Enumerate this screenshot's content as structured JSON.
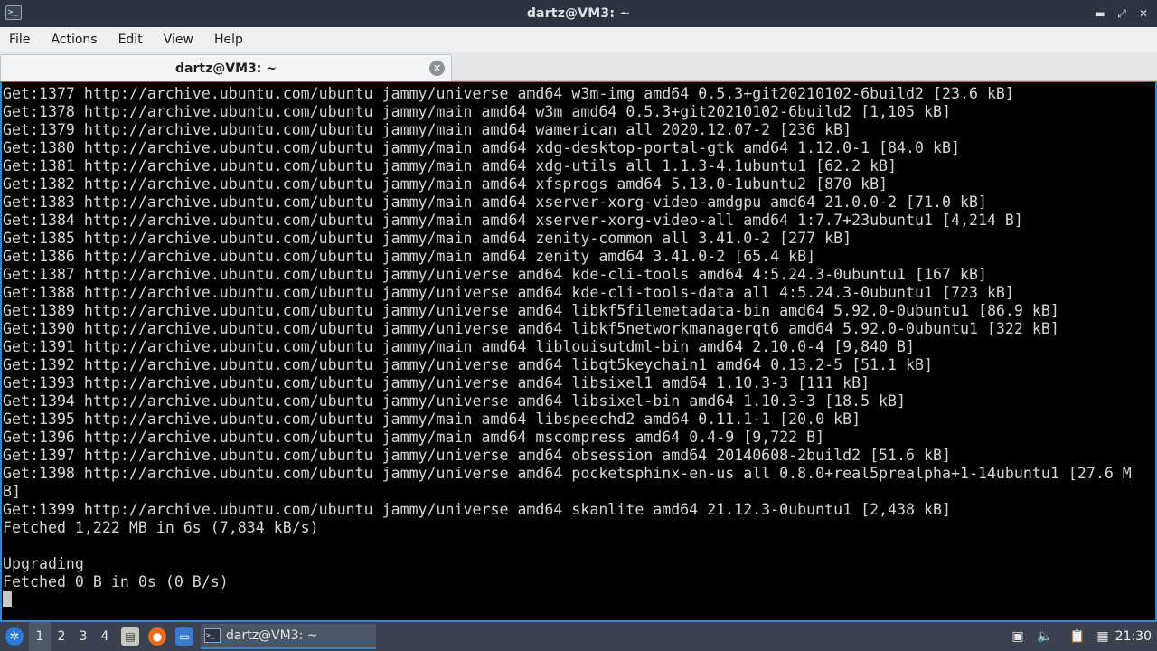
{
  "window": {
    "title": "dartz@VM3: ~",
    "controls": {
      "minimize": "▬",
      "maximize": "⤢",
      "close": "✕"
    }
  },
  "menubar": {
    "items": [
      "File",
      "Actions",
      "Edit",
      "View",
      "Help"
    ]
  },
  "tabs": [
    {
      "label": "dartz@VM3: ~",
      "close_icon": "close-icon"
    }
  ],
  "terminal": {
    "lines": [
      "Get:1377 http://archive.ubuntu.com/ubuntu jammy/universe amd64 w3m-img amd64 0.5.3+git20210102-6build2 [23.6 kB]",
      "Get:1378 http://archive.ubuntu.com/ubuntu jammy/main amd64 w3m amd64 0.5.3+git20210102-6build2 [1,105 kB]",
      "Get:1379 http://archive.ubuntu.com/ubuntu jammy/main amd64 wamerican all 2020.12.07-2 [236 kB]",
      "Get:1380 http://archive.ubuntu.com/ubuntu jammy/main amd64 xdg-desktop-portal-gtk amd64 1.12.0-1 [84.0 kB]",
      "Get:1381 http://archive.ubuntu.com/ubuntu jammy/main amd64 xdg-utils all 1.1.3-4.1ubuntu1 [62.2 kB]",
      "Get:1382 http://archive.ubuntu.com/ubuntu jammy/main amd64 xfsprogs amd64 5.13.0-1ubuntu2 [870 kB]",
      "Get:1383 http://archive.ubuntu.com/ubuntu jammy/main amd64 xserver-xorg-video-amdgpu amd64 21.0.0-2 [71.0 kB]",
      "Get:1384 http://archive.ubuntu.com/ubuntu jammy/main amd64 xserver-xorg-video-all amd64 1:7.7+23ubuntu1 [4,214 B]",
      "Get:1385 http://archive.ubuntu.com/ubuntu jammy/main amd64 zenity-common all 3.41.0-2 [277 kB]",
      "Get:1386 http://archive.ubuntu.com/ubuntu jammy/main amd64 zenity amd64 3.41.0-2 [65.4 kB]",
      "Get:1387 http://archive.ubuntu.com/ubuntu jammy/universe amd64 kde-cli-tools amd64 4:5.24.3-0ubuntu1 [167 kB]",
      "Get:1388 http://archive.ubuntu.com/ubuntu jammy/universe amd64 kde-cli-tools-data all 4:5.24.3-0ubuntu1 [723 kB]",
      "Get:1389 http://archive.ubuntu.com/ubuntu jammy/universe amd64 libkf5filemetadata-bin amd64 5.92.0-0ubuntu1 [86.9 kB]",
      "Get:1390 http://archive.ubuntu.com/ubuntu jammy/universe amd64 libkf5networkmanagerqt6 amd64 5.92.0-0ubuntu1 [322 kB]",
      "Get:1391 http://archive.ubuntu.com/ubuntu jammy/main amd64 liblouisutdml-bin amd64 2.10.0-4 [9,840 B]",
      "Get:1392 http://archive.ubuntu.com/ubuntu jammy/universe amd64 libqt5keychain1 amd64 0.13.2-5 [51.1 kB]",
      "Get:1393 http://archive.ubuntu.com/ubuntu jammy/universe amd64 libsixel1 amd64 1.10.3-3 [111 kB]",
      "Get:1394 http://archive.ubuntu.com/ubuntu jammy/universe amd64 libsixel-bin amd64 1.10.3-3 [18.5 kB]",
      "Get:1395 http://archive.ubuntu.com/ubuntu jammy/main amd64 libspeechd2 amd64 0.11.1-1 [20.0 kB]",
      "Get:1396 http://archive.ubuntu.com/ubuntu jammy/main amd64 mscompress amd64 0.4-9 [9,722 B]",
      "Get:1397 http://archive.ubuntu.com/ubuntu jammy/universe amd64 obsession amd64 20140608-2build2 [51.6 kB]",
      "Get:1398 http://archive.ubuntu.com/ubuntu jammy/universe amd64 pocketsphinx-en-us all 0.8.0+real5prealpha+1-14ubuntu1 [27.6 M",
      "B]",
      "Get:1399 http://archive.ubuntu.com/ubuntu jammy/universe amd64 skanlite amd64 21.12.3-0ubuntu1 [2,438 kB]",
      "Fetched 1,222 MB in 6s (7,834 kB/s)",
      "",
      "Upgrading",
      "Fetched 0 B in 0s (0 B/s)"
    ]
  },
  "taskbar": {
    "workspaces": [
      "1",
      "2",
      "3",
      "4"
    ],
    "active_workspace": "1",
    "launchers": [
      "file-manager-icon",
      "firefox-icon",
      "desktop-icon"
    ],
    "task": {
      "label": "dartz@VM3: ~",
      "icon": "terminal-icon"
    },
    "tray": [
      "notes-icon",
      "volume-icon",
      "clipboard-icon",
      "network-icon"
    ],
    "clock": "21:30"
  },
  "colors": {
    "accent": "#2f86d4",
    "terminal_bg": "#000000",
    "terminal_fg": "#d6d6d6"
  }
}
